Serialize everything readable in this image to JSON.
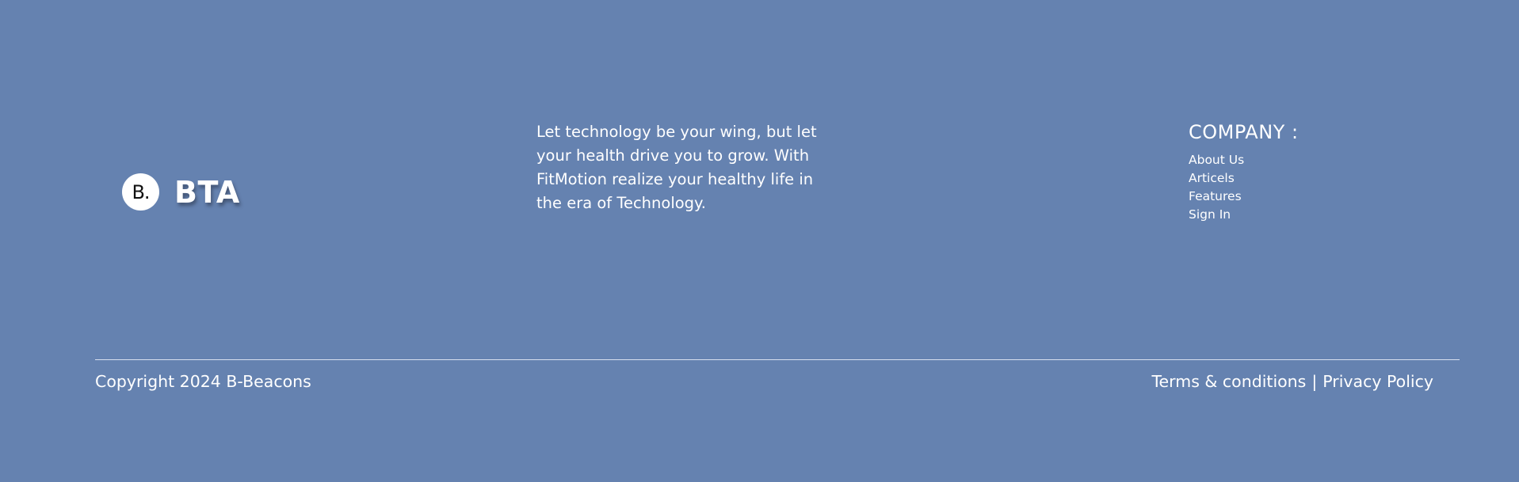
{
  "colors": {
    "background": "#6582b0",
    "text": "#ffffff",
    "logo_badge": "#ffffff",
    "divider": "#d8e0ef"
  },
  "brand": {
    "logo_text": "B.",
    "name": "BTA"
  },
  "tagline": "Let technology be your wing, but let your health drive you to grow. With FitMotion realize your healthy life in the era of Technology.",
  "company": {
    "title": "COMPANY :",
    "links": [
      {
        "label": "About Us"
      },
      {
        "label": "Articels"
      },
      {
        "label": "Features"
      },
      {
        "label": "Sign In"
      }
    ]
  },
  "bottom": {
    "copyright": "Copyright 2024 B-Beacons",
    "terms_label": "Terms & conditions",
    "separator": "|",
    "privacy_label": "Privacy Policy"
  }
}
